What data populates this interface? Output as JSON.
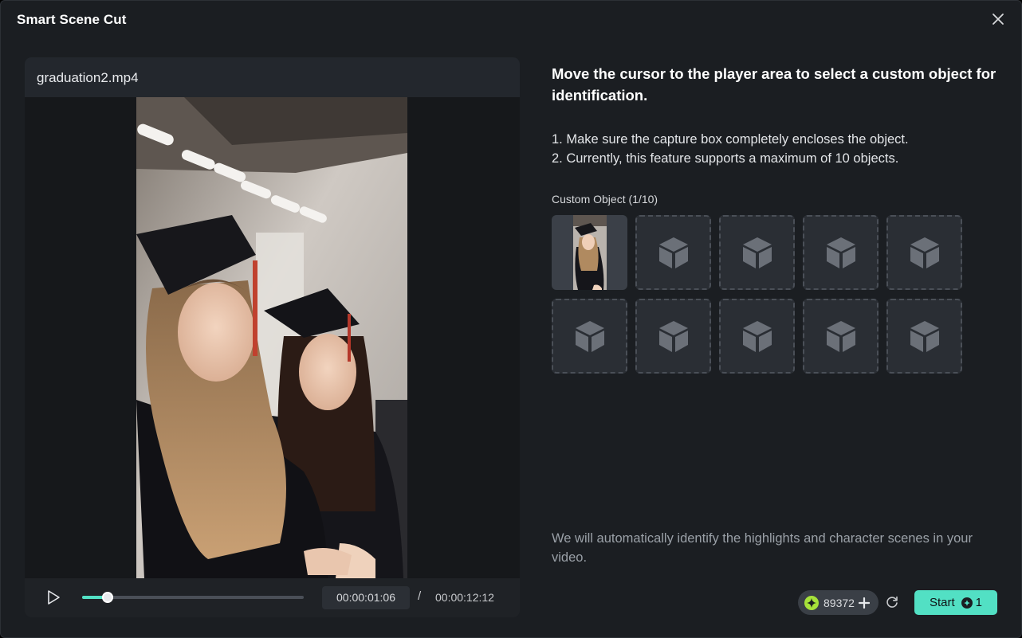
{
  "dialog": {
    "title": "Smart Scene Cut"
  },
  "player": {
    "file_name": "graduation2.mp4",
    "progress": 0.115,
    "current_time": "00:00:01:06",
    "separator": "/",
    "total_time": "00:00:12:12"
  },
  "panel": {
    "headline": "Move the cursor to the player area to select a custom object for identification.",
    "instructions": [
      "1. Make sure the capture box completely encloses the object.",
      "2. Currently, this feature supports a maximum of 10 objects."
    ],
    "custom_object_label": "Custom Object (1/10)",
    "slots_total": 10,
    "slots_filled": 1,
    "footnote": "We will automatically identify the highlights and character scenes in your video."
  },
  "footer": {
    "credits": "89372",
    "start_label": "Start",
    "start_cost": "1"
  },
  "colors": {
    "accent": "#52e0c4",
    "background": "#1b1e22",
    "panel": "#23272d"
  },
  "icons": {
    "close": "close-icon",
    "play": "play-icon",
    "empty_slot": "cube-icon",
    "credit": "credit-sparkle-icon",
    "add": "plus-icon",
    "refresh": "refresh-icon",
    "coin": "coin-icon"
  }
}
